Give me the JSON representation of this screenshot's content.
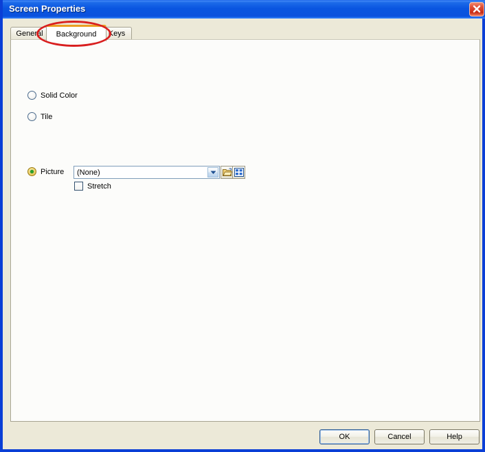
{
  "window": {
    "title": "Screen Properties",
    "close_icon": "close-icon",
    "titlebar_color": "#0b52dd",
    "dialog_bg": "#ece9d8",
    "panel_bg": "#fcfcfa"
  },
  "tabs": [
    {
      "id": "general",
      "label": "General",
      "selected": false
    },
    {
      "id": "background",
      "label": "Background",
      "selected": true
    },
    {
      "id": "keys",
      "label": "Keys",
      "selected": false
    }
  ],
  "background_tab": {
    "options": [
      {
        "id": "solid-color",
        "label": "Solid Color",
        "checked": false
      },
      {
        "id": "tile",
        "label": "Tile",
        "checked": false
      },
      {
        "id": "picture",
        "label": "Picture",
        "checked": true
      }
    ],
    "picture_combo": {
      "value": "(None)",
      "arrow_icon": "chevron-down-icon"
    },
    "browse_button": {
      "icon": "folder-open-icon",
      "tooltip": "Browse"
    },
    "gallery_button": {
      "icon": "grid-gallery-icon",
      "tooltip": "Gallery"
    },
    "stretch": {
      "label": "Stretch",
      "checked": false
    }
  },
  "footer": {
    "ok_label": "OK",
    "cancel_label": "Cancel",
    "help_label": "Help"
  },
  "annotation": {
    "shape": "ellipse",
    "color": "#d91f1f",
    "targets": "Background tab"
  }
}
